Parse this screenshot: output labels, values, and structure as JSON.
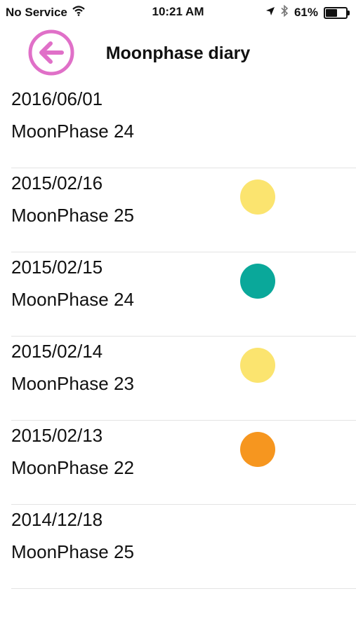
{
  "status": {
    "carrier": "No Service",
    "time": "10:21 AM",
    "battery": "61%",
    "battery_level": 0.61
  },
  "nav": {
    "title": "Moonphase diary",
    "back_icon": "back-arrow-icon",
    "back_color": "#e070c8"
  },
  "colors": {
    "moon": "#f7c94b",
    "pale_yellow": "#fbe46f",
    "teal": "#0aa89a",
    "orange": "#f6961f"
  },
  "entries": [
    {
      "date": "2016/06/01",
      "phase": "MoonPhase 24",
      "dot": null
    },
    {
      "date": "2015/02/16",
      "phase": "MoonPhase 25",
      "dot": "#fbe46f"
    },
    {
      "date": "2015/02/15",
      "phase": "MoonPhase 24",
      "dot": "#0aa89a"
    },
    {
      "date": "2015/02/14",
      "phase": "MoonPhase 23",
      "dot": "#fbe46f"
    },
    {
      "date": "2015/02/13",
      "phase": "MoonPhase 22",
      "dot": "#f6961f"
    },
    {
      "date": "2014/12/18",
      "phase": "MoonPhase 25",
      "dot": null
    }
  ]
}
